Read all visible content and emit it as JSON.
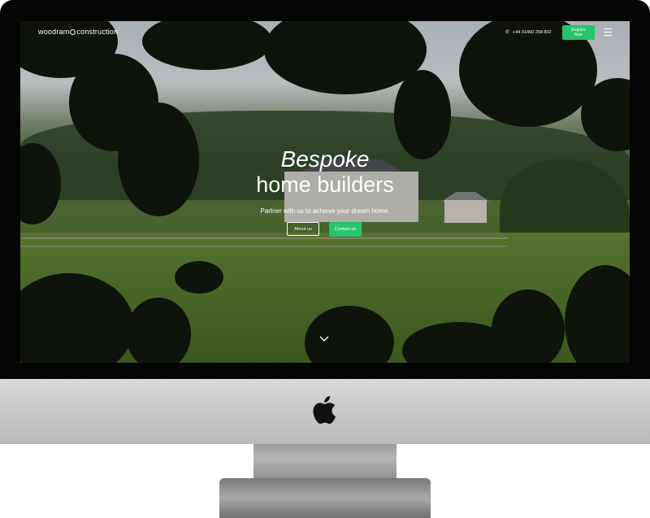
{
  "header": {
    "logo_prefix": "woodram",
    "logo_suffix": "construction",
    "phone_icon": "phone-icon",
    "phone": "+44 01460 258 802",
    "enquire_label": "Enquire Now",
    "menu_icon": "hamburger-menu-icon"
  },
  "hero": {
    "title_line1": "Bespoke",
    "title_line2": "home builders",
    "subtitle": "Partner with us to achieve your dream home.",
    "about_label": "About us",
    "contact_label": "Contact us",
    "scroll_icon": "chevron-down-icon"
  },
  "colors": {
    "accent": "#27c46b",
    "text": "#ffffff",
    "bezel": "#050505"
  },
  "device": {
    "brand_icon": "apple-logo-icon"
  }
}
